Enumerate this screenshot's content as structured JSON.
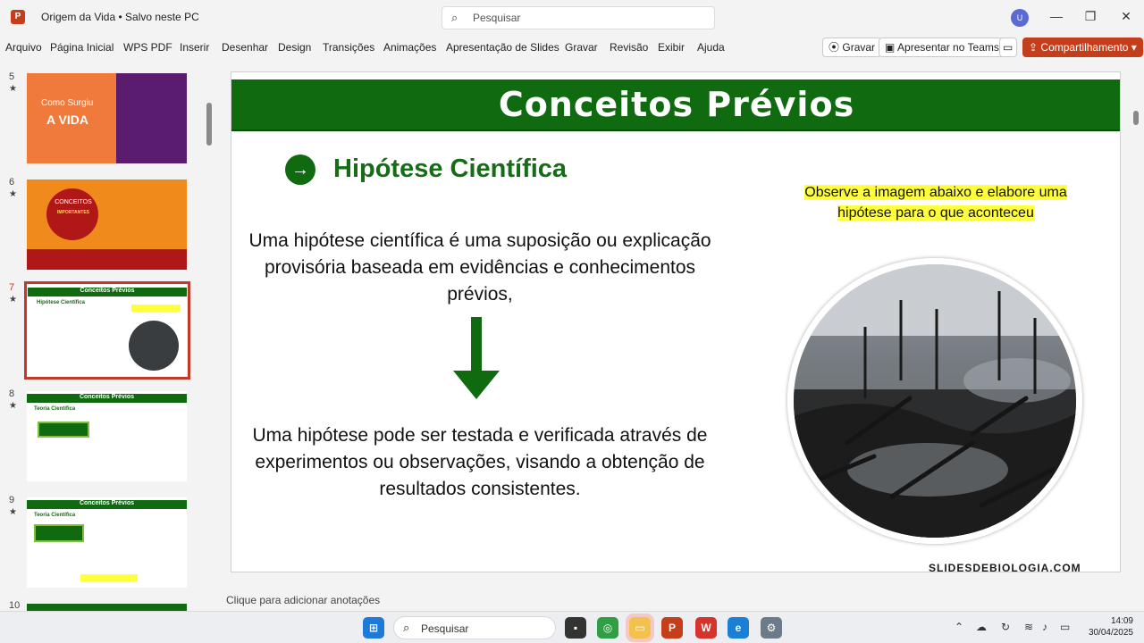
{
  "window": {
    "title": "Origem da Vida • Salvo neste PC",
    "search_placeholder": "Pesquisar",
    "user_initial": "U"
  },
  "ribbon": {
    "menu": [
      "Arquivo",
      "Página Inicial",
      "WPS PDF",
      "Inserir",
      "Desenhar",
      "Design",
      "Transições",
      "Animações",
      "Apresentação de Slides",
      "Gravar",
      "Revisão",
      "Exibir",
      "Ajuda"
    ],
    "record_btn": "Gravar",
    "teams_btn": "Apresentar no Teams",
    "share_btn": "Compartilhamento"
  },
  "thumbnails": [
    {
      "num": "5",
      "title": "Como Surgiu",
      "subtitle": "A VIDA"
    },
    {
      "num": "6",
      "title": "CONCEITOS",
      "subtitle": "IMPORTANTES"
    },
    {
      "num": "7",
      "title": "Conceitos Prévios",
      "subtitle": "Hipótese Científica"
    },
    {
      "num": "8",
      "title": "Conceitos Prévios",
      "subtitle": "Teoria Científica"
    },
    {
      "num": "9",
      "title": "Conceitos Prévios",
      "subtitle": "Teoria Científica"
    },
    {
      "num": "10"
    }
  ],
  "slide": {
    "title": "Conceitos Prévios",
    "bullet_icon": "→",
    "heading": "Hipótese Científica",
    "note": "Observe a imagem abaixo e elabore uma hipótese para o que aconteceu",
    "paragraph1": "Uma hipótese científica é uma suposição ou explicação provisória baseada em evidências e conhecimentos prévios,",
    "paragraph2": "Uma hipótese pode ser testada e verificada através de experimentos ou observações, visando a obtenção de resultados consistentes.",
    "watermark": "SLIDESDEBIOLOGIA.COM"
  },
  "notes": {
    "placeholder": "Clique para adicionar anotações"
  },
  "taskbar": {
    "search": "Pesquisar",
    "time": "14:09",
    "date": "30/04/2025"
  },
  "colors": {
    "header_green": "#0f6a10",
    "heading_green": "#156d15",
    "highlight": "#ffff3c",
    "share_red": "#c43e1c"
  }
}
